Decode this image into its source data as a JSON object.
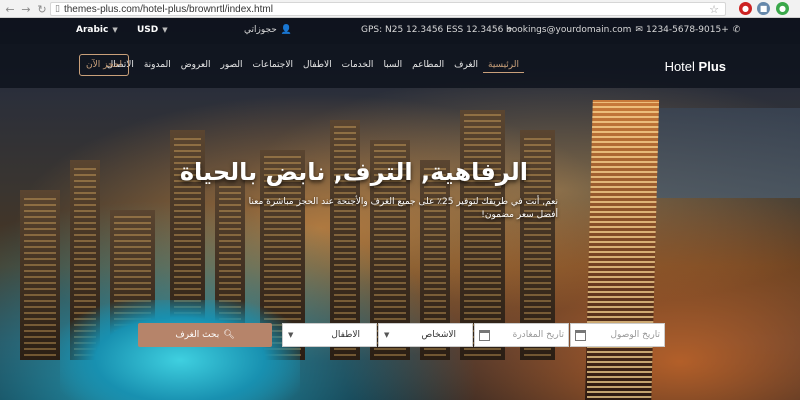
{
  "browser": {
    "url": "themes-plus.com/hotel-plus/brownrtl/index.html",
    "back_icon": "arrow-left-icon",
    "forward_icon": "arrow-right-icon"
  },
  "topbar": {
    "language": "Arabic",
    "currency": "USD",
    "account": "حجوزاتي",
    "gps": "GPS: N25 12.3456 ESS 12.3456",
    "email": "bookings@yourdomain.com",
    "phone": "1234-5678-9015+"
  },
  "nav": {
    "logo_light": "Hotel ",
    "logo_bold": "Plus",
    "items": [
      "الرئيسية",
      "الغرف",
      "المطاعم",
      "السبا",
      "الخدمات",
      "الاطفال",
      "الاجتماعات",
      "الصور",
      "العروض",
      "المدونة",
      "الاتصال"
    ],
    "book_button": "احجز الآن"
  },
  "hero": {
    "headline": "الرفاهية, الترف, نابض بالحياة",
    "subline_1": "نعم, أنت في طريقك لتوفير 25٪ على جميع الغرف والأجنحة عند الحجز مباشرة معنا",
    "subline_2": "أفضل سعر مضمون!"
  },
  "search": {
    "button": "بحث الغرف",
    "children": "الاطفال",
    "adults": "الاشخاص",
    "checkout": "تاريخ المغادرة",
    "checkin": "تاريخ الوصول"
  },
  "colors": {
    "accent": "#b6846a",
    "accent_text": "#c9a07a"
  }
}
